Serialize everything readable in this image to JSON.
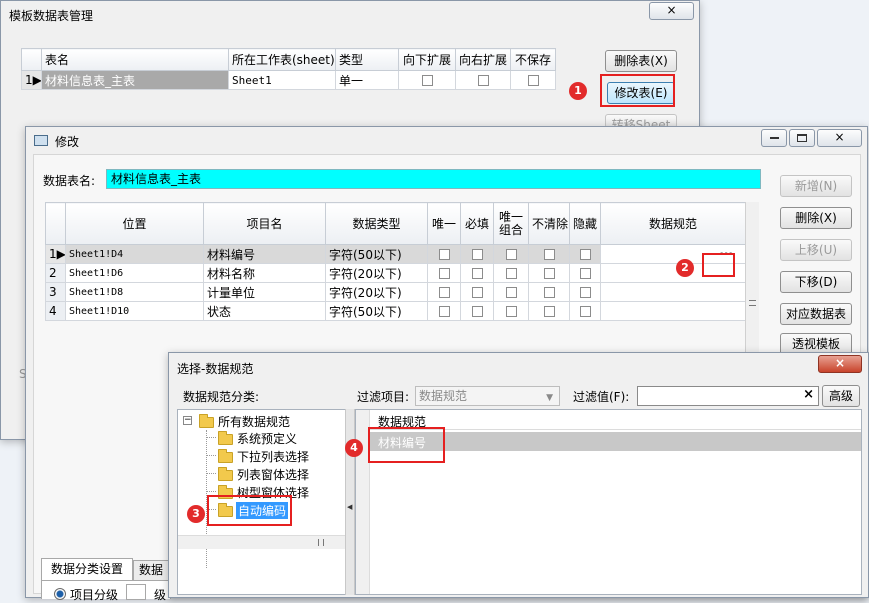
{
  "main_window": {
    "title": "模板数据表管理",
    "close_icon": "×",
    "grid": {
      "headers": [
        "表名",
        "所在工作表(sheet)",
        "类型",
        "向下扩展",
        "向右扩展",
        "不保存"
      ],
      "rows": [
        {
          "index": "1",
          "name": "材料信息表_主表",
          "sheet": "Sheet1",
          "type": "单一"
        }
      ]
    },
    "buttons": {
      "delete": "删除表(X)",
      "modify": "修改表(E)",
      "transfer": "转移Sheet"
    },
    "status_fragment": "S"
  },
  "modify_window": {
    "title": "修改",
    "table_name_label": "数据表名:",
    "table_name_value": "材料信息表_主表",
    "grid": {
      "headers": [
        "位置",
        "项目名",
        "数据类型",
        "唯一",
        "必填",
        "唯一组合",
        "不清除",
        "隐藏",
        "数据规范"
      ],
      "rows": [
        {
          "index": "1",
          "position": "Sheet1!D4",
          "item": "材料编号",
          "type": "字符(50以下)",
          "rule_button": "···"
        },
        {
          "index": "2",
          "position": "Sheet1!D6",
          "item": "材料名称",
          "type": "字符(20以下)"
        },
        {
          "index": "3",
          "position": "Sheet1!D8",
          "item": "计量单位",
          "type": "字符(20以下)"
        },
        {
          "index": "4",
          "position": "Sheet1!D10",
          "item": "状态",
          "type": "字符(50以下)"
        }
      ]
    },
    "buttons": {
      "add": "新增(N)",
      "delete": "删除(X)",
      "up": "上移(U)",
      "down": "下移(D)",
      "map_table": "对应数据表",
      "pivot_template": "透视模板"
    },
    "tabs": [
      "数据分类设置",
      "数据"
    ],
    "radio_label": "项目分级",
    "fragment": "级"
  },
  "select_dialog": {
    "title": "选择-数据规范",
    "category_label": "数据规范分类:",
    "filter_item_label": "过滤项目:",
    "filter_item_value": "数据规范",
    "filter_value_label": "过滤值(F):",
    "filter_value": "",
    "clear_icon": "×",
    "advanced_button": "高级",
    "tree": {
      "root": "所有数据规范",
      "expander": "−",
      "children": [
        "系统预定义",
        "下拉列表选择",
        "列表窗体选择",
        "树型窗体选择",
        "自动编码"
      ]
    },
    "list": {
      "header": "数据规范",
      "rows": [
        "材料编号"
      ]
    }
  },
  "annotations": [
    "1",
    "2",
    "3",
    "4"
  ],
  "colors": {
    "accent_cyan": "#00ffff",
    "highlight_red": "#e52020",
    "selection_blue": "#3399ff"
  }
}
